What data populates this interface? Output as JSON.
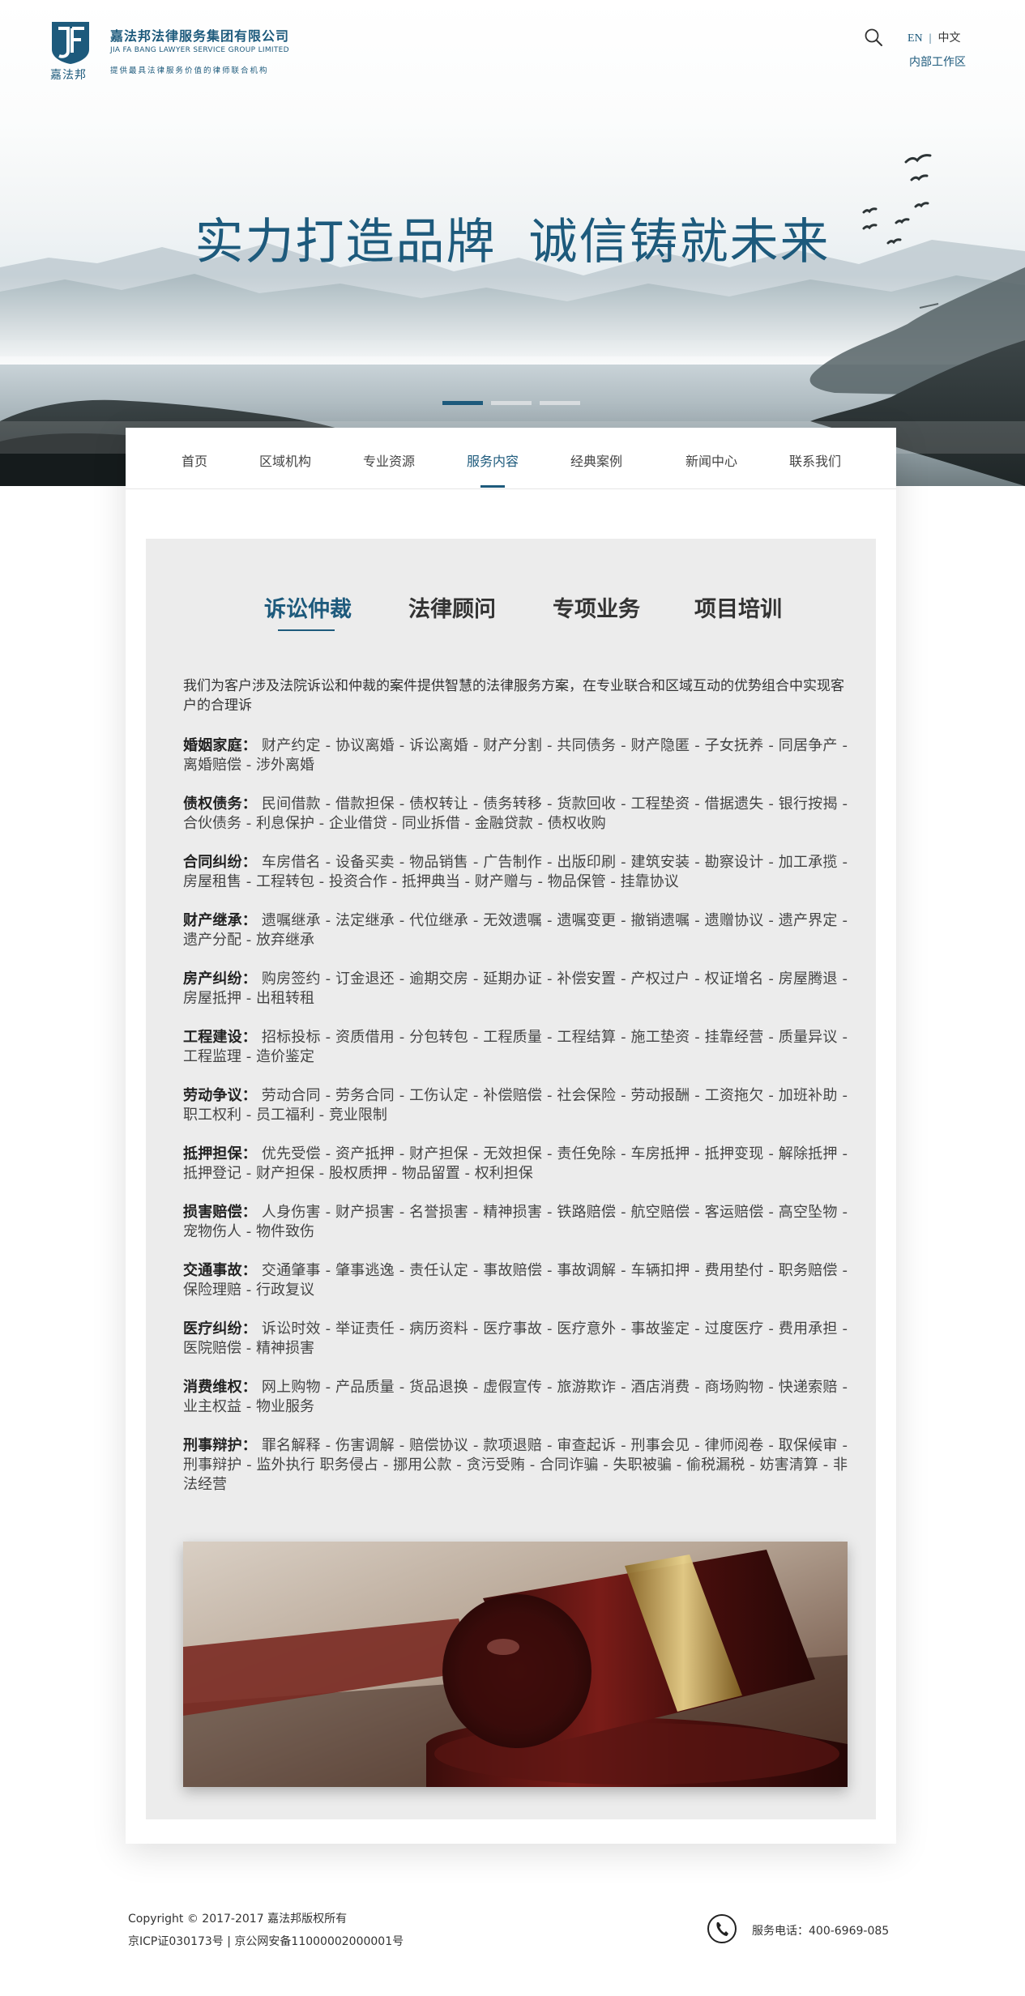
{
  "header": {
    "logo_mark_text": "JF",
    "logo_sub": "嘉法邦",
    "company_cn": "嘉法邦法律服务集团有限公司",
    "company_en": "JIA FA BANG LAWYER SERVICE GROUP LIMITED",
    "tagline": "提供最具法律服务价值的律师联合机构",
    "lang_en": "EN",
    "lang_sep": "|",
    "lang_cn": "中文",
    "internal": "内部工作区"
  },
  "hero": {
    "slogan_left": "实力打造品牌",
    "slogan_right": "诚信铸就未来",
    "slides": 3,
    "active_slide": 1
  },
  "nav": {
    "items": [
      "首页",
      "区域机构",
      "专业资源",
      "服务内容",
      "经典案例",
      "新闻中心",
      "联系我们"
    ],
    "active": "服务内容"
  },
  "tabs": {
    "items": [
      "诉讼仲裁",
      "法律顾问",
      "专项业务",
      "项目培训"
    ],
    "active": "诉讼仲裁"
  },
  "intro": "我们为客户涉及法院诉讼和仲裁的案件提供智慧的法律服务方案，在专业联合和区域互动的优势组合中实现客户的合理诉",
  "categories": [
    {
      "title": "婚姻家庭：",
      "text": "财产约定 - 协议离婚 - 诉讼离婚 - 财产分割 - 共同债务 - 财产隐匿 - 子女抚养 - 同居争产 - 离婚赔偿 - 涉外离婚"
    },
    {
      "title": "债权债务：",
      "text": "民间借款 - 借款担保 - 债权转让 - 债务转移 - 货款回收 - 工程垫资 - 借据遗失 - 银行按揭 - 合伙债务 - 利息保护 - 企业借贷 - 同业拆借 - 金融贷款 - 债权收购"
    },
    {
      "title": "合同纠纷：",
      "text": "车房借名 - 设备买卖 - 物品销售 - 广告制作 - 出版印刷 - 建筑安装 - 勘察设计 - 加工承揽 - 房屋租售 - 工程转包 - 投资合作 - 抵押典当 - 财产赠与 - 物品保管 - 挂靠协议"
    },
    {
      "title": "财产继承：",
      "text": "遗嘱继承 - 法定继承 - 代位继承 - 无效遗嘱 - 遗嘱变更 - 撤销遗嘱 - 遗赠协议 - 遗产界定 - 遗产分配 - 放弃继承"
    },
    {
      "title": "房产纠纷：",
      "text": "购房签约 - 订金退还 - 逾期交房 - 延期办证 - 补偿安置 - 产权过户 - 权证增名 - 房屋腾退 - 房屋抵押 - 出租转租"
    },
    {
      "title": "工程建设：",
      "text": "招标投标 - 资质借用 - 分包转包 - 工程质量 - 工程结算 - 施工垫资 - 挂靠经营 - 质量异议 - 工程监理 - 造价鉴定"
    },
    {
      "title": "劳动争议：",
      "text": "劳动合同 - 劳务合同 - 工伤认定 - 补偿赔偿 - 社会保险 - 劳动报酬 - 工资拖欠 - 加班补助 - 职工权利 - 员工福利 - 竞业限制"
    },
    {
      "title": "抵押担保：",
      "text": "优先受偿 - 资产抵押 - 财产担保 - 无效担保 - 责任免除 - 车房抵押 - 抵押变现 - 解除抵押 - 抵押登记 - 财产担保 - 股权质押 - 物品留置 - 权利担保"
    },
    {
      "title": "损害赔偿：",
      "text": "人身伤害 - 财产损害 - 名誉损害 - 精神损害 - 铁路赔偿 - 航空赔偿 - 客运赔偿 - 高空坠物 - 宠物伤人 - 物件致伤"
    },
    {
      "title": "交通事故：",
      "text": "交通肇事 - 肇事逃逸 - 责任认定 - 事故赔偿 - 事故调解 - 车辆扣押 - 费用垫付 - 职务赔偿 - 保险理赔 - 行政复议"
    },
    {
      "title": "医疗纠纷：",
      "text": "诉讼时效 - 举证责任 - 病历资料 - 医疗事故 - 医疗意外 - 事故鉴定 - 过度医疗 - 费用承担 - 医院赔偿 - 精神损害"
    },
    {
      "title": "消费维权：",
      "text": "网上购物 - 产品质量 - 货品退换 - 虚假宣传 - 旅游欺诈 - 酒店消费 - 商场购物 - 快递索赔 - 业主权益 - 物业服务"
    },
    {
      "title": "刑事辩护：",
      "text": "罪名解释 - 伤害调解 - 赔偿协议 - 款项退赔 - 审查起诉 - 刑事会见 - 律师阅卷 - 取保候审 - 刑事辩护 - 监外执行  职务侵占 - 挪用公款 - 贪污受贿 - 合同诈骗 - 失职被骗 - 偷税漏税 - 妨害清算 - 非法经营"
    }
  ],
  "footer": {
    "copyright": "Copyright © 2017-2017 嘉法邦版权所有",
    "icp": "京ICP证030173号 | 京公网安备11000002000001号",
    "phone": "服务电话：400-6969-085"
  },
  "colors": {
    "brand": "#1d5a7c",
    "panel": "#ececec",
    "text": "#333333"
  },
  "icons": {
    "search": "search-icon",
    "phone": "phone-icon"
  }
}
